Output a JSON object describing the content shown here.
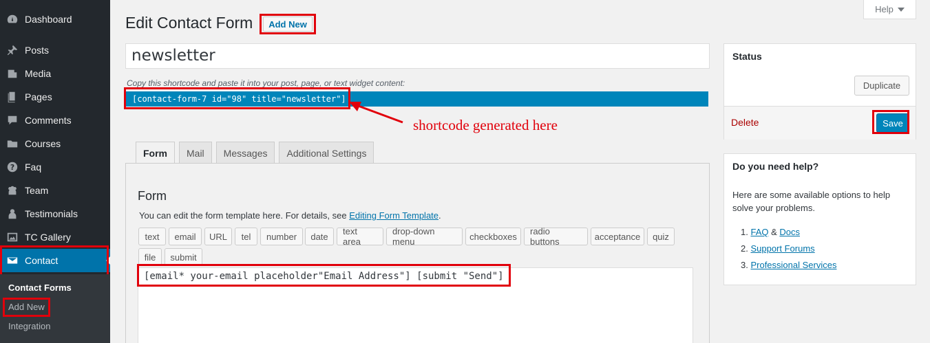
{
  "sidebar": {
    "items": [
      {
        "label": "Dashboard",
        "icon": "dashboard-icon"
      },
      {
        "label": "Posts",
        "icon": "pin-icon"
      },
      {
        "label": "Media",
        "icon": "media-icon"
      },
      {
        "label": "Pages",
        "icon": "pages-icon"
      },
      {
        "label": "Comments",
        "icon": "comment-icon"
      },
      {
        "label": "Courses",
        "icon": "folder-icon"
      },
      {
        "label": "Faq",
        "icon": "question-icon"
      },
      {
        "label": "Team",
        "icon": "team-icon"
      },
      {
        "label": "Testimonials",
        "icon": "person-icon"
      },
      {
        "label": "TC Gallery",
        "icon": "gallery-icon"
      },
      {
        "label": "Contact",
        "icon": "envelope-icon",
        "active": true
      }
    ],
    "submenu": [
      "Contact Forms",
      "Add New",
      "Integration"
    ]
  },
  "header": {
    "title": "Edit Contact Form",
    "add_new": "Add New",
    "help": "Help"
  },
  "form_title": "newsletter",
  "shortcode": {
    "hint": "Copy this shortcode and paste it into your post, page, or text widget content:",
    "value": "[contact-form-7 id=\"98\" title=\"newsletter\"]"
  },
  "annotation": "shortcode generated here",
  "tabs": [
    "Form",
    "Mail",
    "Messages",
    "Additional Settings"
  ],
  "panel": {
    "heading": "Form",
    "desc_prefix": "You can edit the form template here. For details, see ",
    "desc_link": "Editing Form Template",
    "desc_suffix": ".",
    "tag_buttons_row1": [
      "text",
      "email",
      "URL",
      "tel",
      "number",
      "date",
      "text area",
      "drop-down menu",
      "checkboxes",
      "radio buttons",
      "acceptance",
      "quiz"
    ],
    "tag_buttons_row2": [
      "file",
      "submit"
    ],
    "template": "[email* your-email placeholder\"Email Address\"] [submit \"Send\"]"
  },
  "status": {
    "title": "Status",
    "duplicate": "Duplicate",
    "delete": "Delete",
    "save": "Save"
  },
  "help_box": {
    "title": "Do you need help?",
    "desc": "Here are some available options to help solve your problems.",
    "item1_num": "1.",
    "item1_link_a": "FAQ",
    "item1_amp": " & ",
    "item1_link_b": "Docs",
    "item2_num": "2.",
    "item2_link": "Support Forums",
    "item3_num": "3.",
    "item3_link": "Professional Services"
  },
  "colors": {
    "sidebar_bg": "#23282d",
    "accent": "#0073aa",
    "shortcode_bg": "#0085ba",
    "annotation_red": "#e1000b"
  }
}
